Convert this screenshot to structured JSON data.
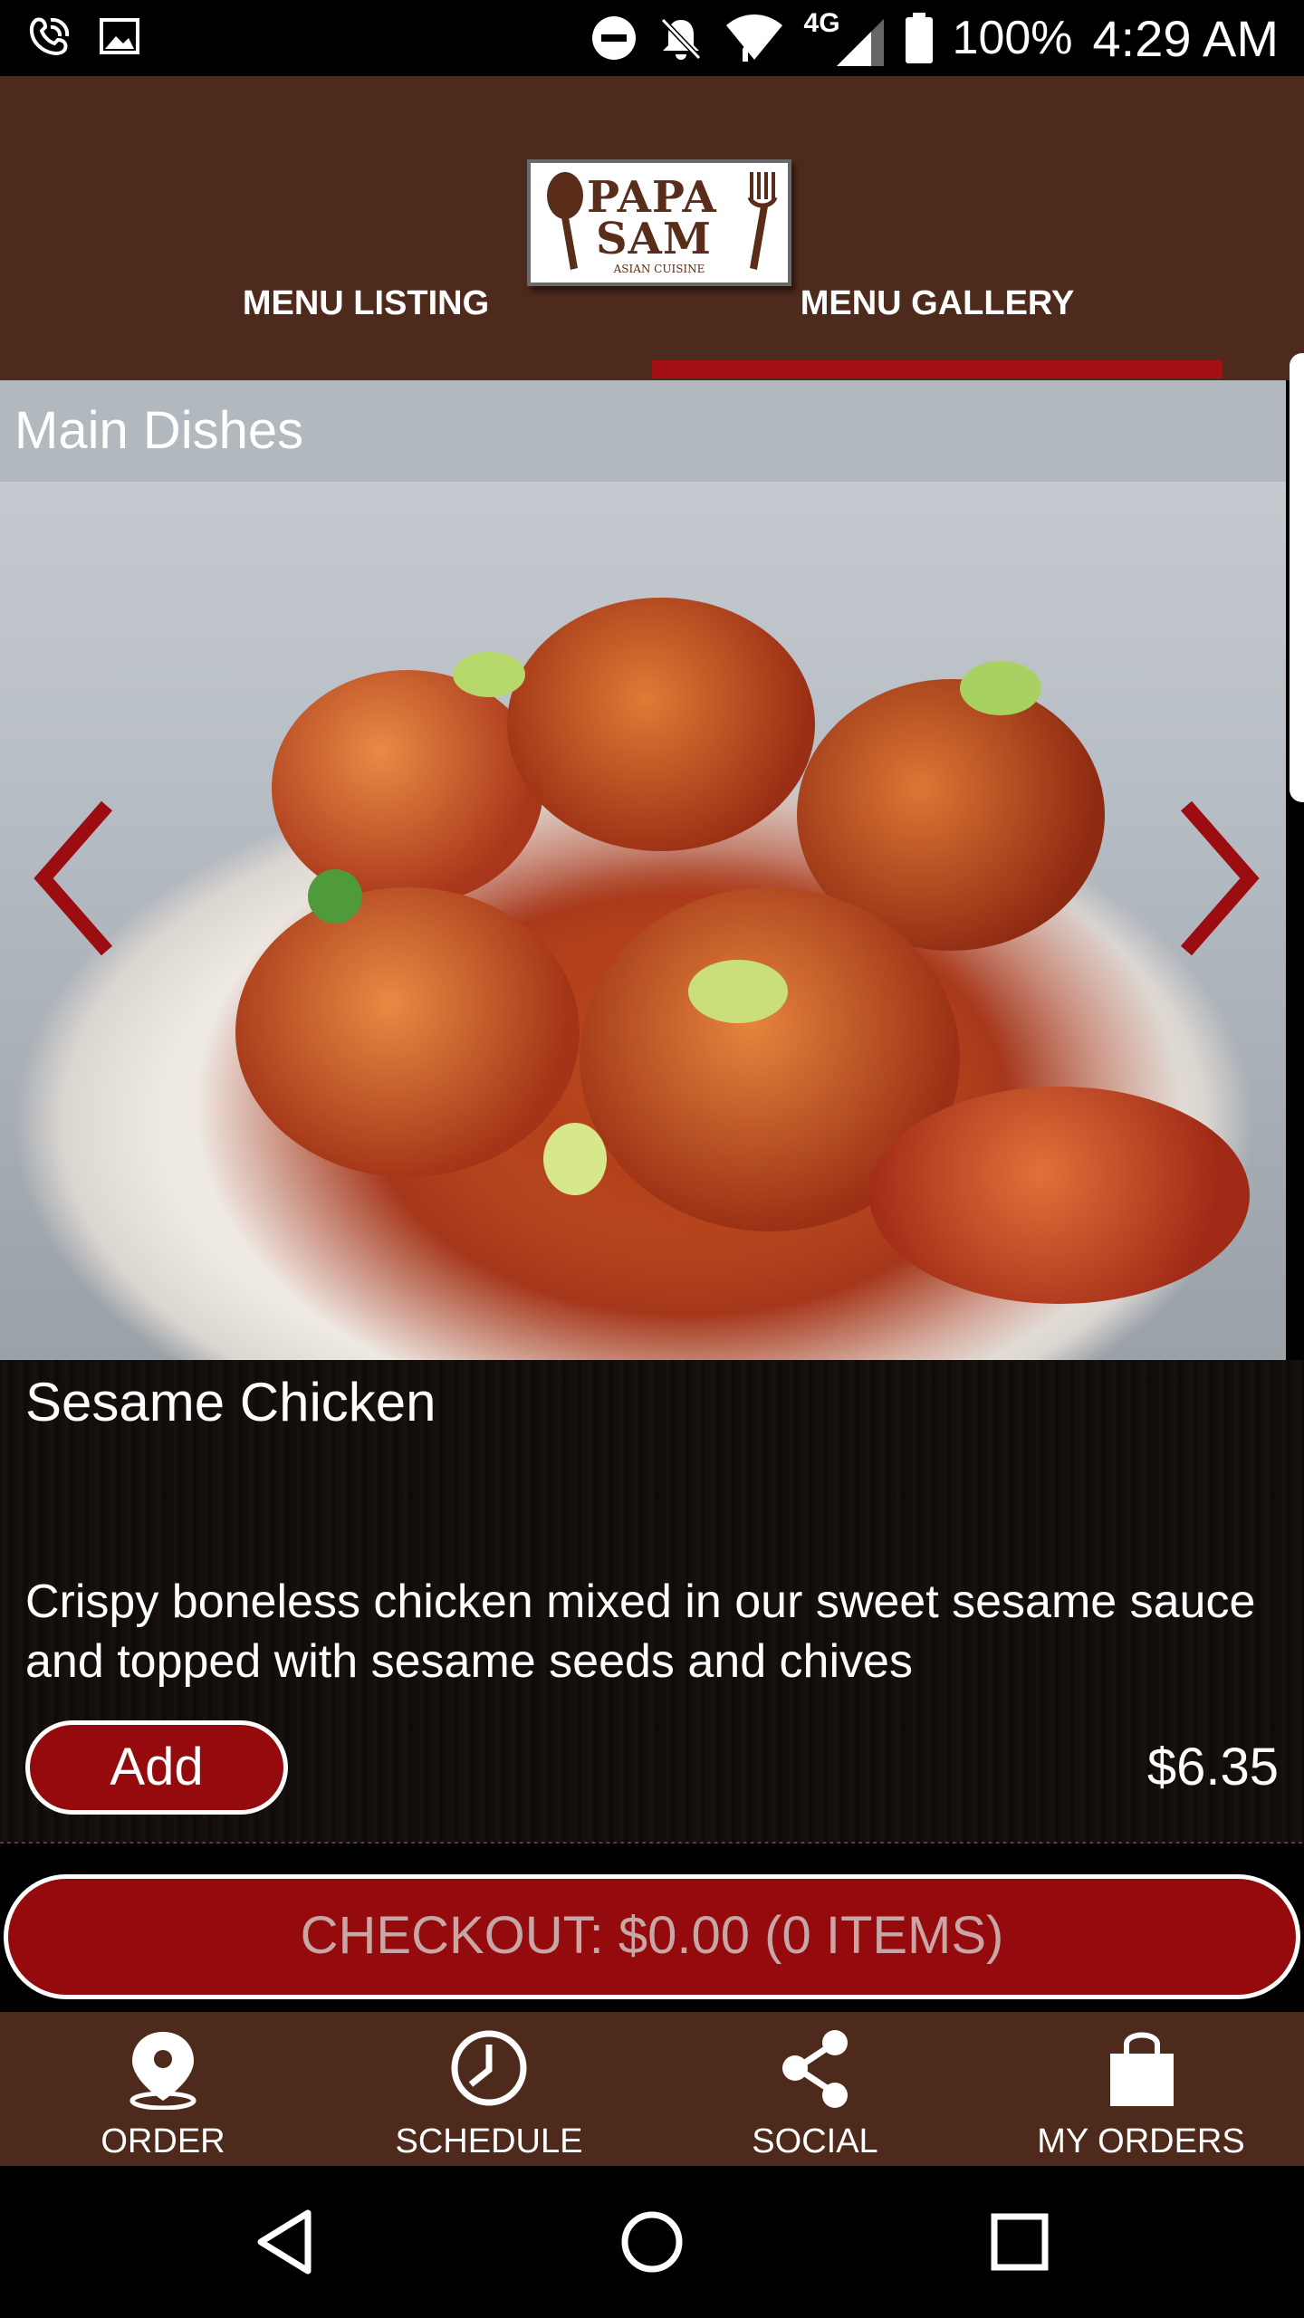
{
  "status_bar": {
    "battery": "100%",
    "time": "4:29 AM",
    "network": "4G",
    "icons": [
      "wifi-calling-icon",
      "image-icon",
      "do-not-disturb-icon",
      "notifications-off-icon",
      "wifi-icon",
      "signal-icon",
      "battery-icon"
    ]
  },
  "header": {
    "logo": {
      "line1": "PAPA",
      "line2": "SAM",
      "subtitle": "ASIAN CUISINE"
    },
    "tabs": [
      {
        "label": "MENU LISTING",
        "selected": false
      },
      {
        "label": "MENU GALLERY",
        "selected": true
      }
    ],
    "accent_color": "#a30f12",
    "background_color": "#4e2a1c"
  },
  "gallery": {
    "category": "Main Dishes",
    "prev_icon": "chevron-left-icon",
    "next_icon": "chevron-right-icon"
  },
  "item": {
    "name": "Sesame Chicken",
    "description": "Crispy boneless chicken mixed in our sweet sesame sauce and topped with sesame seeds and chives",
    "add_label": "Add",
    "price": "$6.35"
  },
  "checkout": {
    "label": "CHECKOUT: $0.00 (0 ITEMS)",
    "color": "#940a0d"
  },
  "bottom_nav": [
    {
      "label": "ORDER",
      "icon": "location-pin-icon"
    },
    {
      "label": "SCHEDULE",
      "icon": "clock-icon"
    },
    {
      "label": "SOCIAL",
      "icon": "share-icon"
    },
    {
      "label": "MY ORDERS",
      "icon": "shopping-bag-icon"
    }
  ],
  "system_nav": [
    "back-icon",
    "home-icon",
    "recents-icon"
  ]
}
